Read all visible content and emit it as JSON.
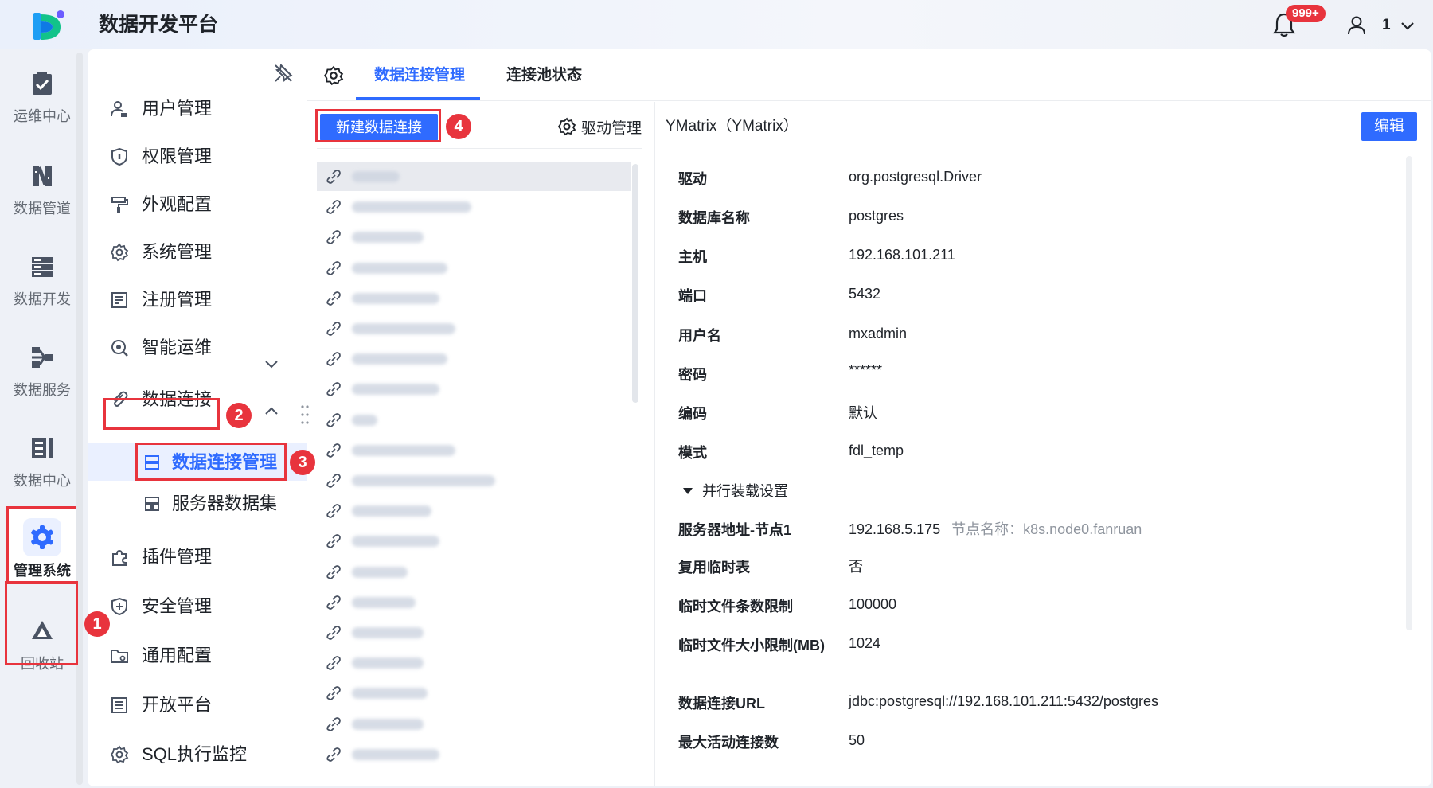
{
  "app": {
    "title": "数据开发平台",
    "notification_count": "999+",
    "user_name": "1"
  },
  "left_nav": [
    {
      "label": "运维中心",
      "icon": "clipboard-check-icon"
    },
    {
      "label": "数据管道",
      "icon": "pipeline-icon"
    },
    {
      "label": "数据开发",
      "icon": "server-stack-icon"
    },
    {
      "label": "数据服务",
      "icon": "service-icon"
    },
    {
      "label": "数据中心",
      "icon": "data-center-icon"
    },
    {
      "label": "管理系统",
      "icon": "gear-icon",
      "active": true
    },
    {
      "label": "回收站",
      "icon": "recycle-icon"
    }
  ],
  "submenu": {
    "items": [
      {
        "label": "用户管理",
        "icon": "user-icon"
      },
      {
        "label": "权限管理",
        "icon": "shield-icon"
      },
      {
        "label": "外观配置",
        "icon": "paint-roller-icon"
      },
      {
        "label": "系统管理",
        "icon": "gear-icon"
      },
      {
        "label": "注册管理",
        "icon": "register-icon"
      },
      {
        "label": "智能运维",
        "icon": "smart-ops-icon"
      },
      {
        "label": "数据连接",
        "icon": "paperclip-icon"
      },
      {
        "label": "插件管理",
        "icon": "puzzle-icon"
      },
      {
        "label": "安全管理",
        "icon": "security-shield-icon"
      },
      {
        "label": "通用配置",
        "icon": "folder-gear-icon"
      },
      {
        "label": "开放平台",
        "icon": "list-icon"
      },
      {
        "label": "SQL执行监控",
        "icon": "gear-icon"
      }
    ],
    "sub_items": [
      {
        "label": "数据连接管理",
        "icon": "database-icon"
      },
      {
        "label": "服务器数据集",
        "icon": "dataset-icon"
      }
    ]
  },
  "annotations": [
    "1",
    "2",
    "3",
    "4"
  ],
  "tabs": [
    {
      "label": "数据连接管理",
      "active": true
    },
    {
      "label": "连接池状态",
      "active": false
    }
  ],
  "toolbar": {
    "new_connection": "新建数据连接",
    "driver_manage": "驱动管理"
  },
  "connections": {
    "count": 20,
    "selected_index": 0
  },
  "detail": {
    "title": "YMatrix（YMatrix）",
    "edit": "编辑",
    "fields": [
      {
        "label": "驱动",
        "value": "org.postgresql.Driver"
      },
      {
        "label": "数据库名称",
        "value": "postgres"
      },
      {
        "label": "主机",
        "value": "192.168.101.211"
      },
      {
        "label": "端口",
        "value": "5432"
      },
      {
        "label": "用户名",
        "value": "mxadmin"
      },
      {
        "label": "密码",
        "value": "******"
      },
      {
        "label": "编码",
        "value": "默认"
      },
      {
        "label": "模式",
        "value": "fdl_temp"
      }
    ],
    "section_title": "并行装载设置",
    "section_fields": [
      {
        "label": "服务器地址-节点1",
        "value": "192.168.5.175",
        "extra": "节点名称：k8s.node0.fanruan"
      },
      {
        "label": "复用临时表",
        "value": "否"
      },
      {
        "label": "临时文件条数限制",
        "value": "100000"
      },
      {
        "label": "临时文件大小限制(MB)",
        "value": "1024"
      }
    ],
    "extra_fields": [
      {
        "label": "数据连接URL",
        "value": "jdbc:postgresql://192.168.101.211:5432/postgres"
      },
      {
        "label": "最大活动连接数",
        "value": "50"
      }
    ]
  },
  "colors": {
    "primary": "#2f6bff",
    "annotation_red": "#e8343d",
    "nav_bg": "#eef1f7"
  }
}
